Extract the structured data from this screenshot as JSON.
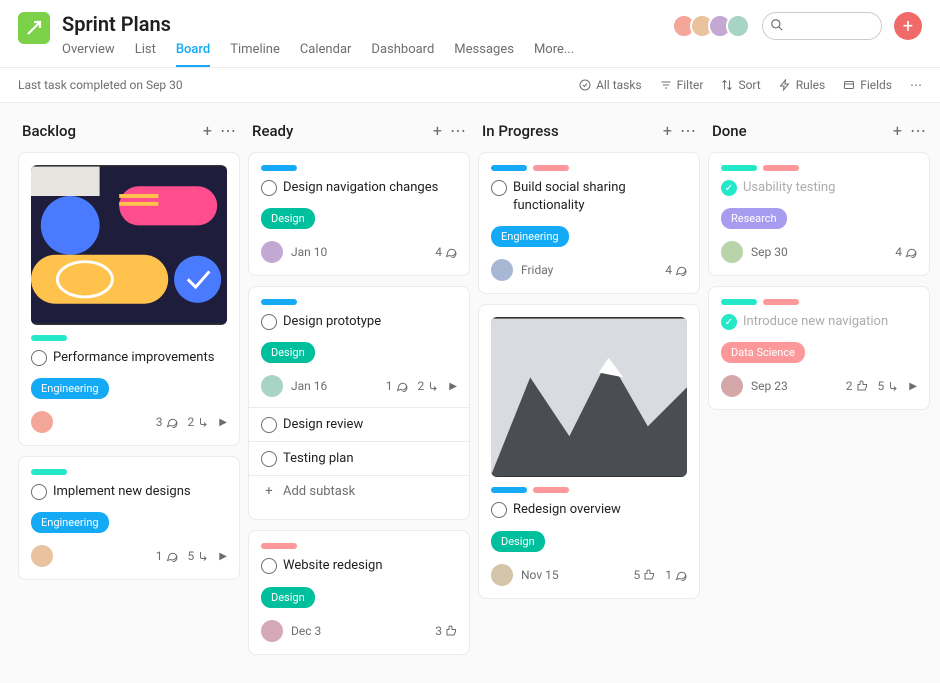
{
  "header": {
    "title": "Sprint Plans",
    "tabs": [
      "Overview",
      "List",
      "Board",
      "Timeline",
      "Calendar",
      "Dashboard",
      "Messages",
      "More..."
    ],
    "active_tab": "Board",
    "search_placeholder": ""
  },
  "toolbar": {
    "status": "Last task completed on Sep 30",
    "all_tasks": "All tasks",
    "filter": "Filter",
    "sort": "Sort",
    "rules": "Rules",
    "fields": "Fields"
  },
  "columns": [
    {
      "name": "Backlog",
      "cards": [
        {
          "has_cover": true,
          "cover_type": "abstract",
          "pills": [
            "teal"
          ],
          "title": "Performance improvements",
          "tag": {
            "label": "Engineering",
            "class": "engineering"
          },
          "assignee": "p1",
          "date": "",
          "stats": {
            "comments": 3,
            "subtasks": 2,
            "expand": true
          }
        },
        {
          "pills": [
            "teal"
          ],
          "title": "Implement new designs",
          "tag": {
            "label": "Engineering",
            "class": "engineering"
          },
          "assignee": "p2",
          "date": "",
          "stats": {
            "comments": 1,
            "subtasks": 5,
            "expand": true
          }
        }
      ]
    },
    {
      "name": "Ready",
      "cards": [
        {
          "pills": [
            "blue"
          ],
          "title": "Design navigation changes",
          "tag": {
            "label": "Design",
            "class": "design"
          },
          "assignee": "p3",
          "date": "Jan 10",
          "stats": {
            "comments": 4
          }
        },
        {
          "pills": [
            "blue"
          ],
          "title": "Design prototype",
          "tag": {
            "label": "Design",
            "class": "design"
          },
          "assignee": "p4",
          "date": "Jan 16",
          "stats": {
            "comments": 1,
            "subtasks": 2,
            "expand": true
          },
          "subtask_list": [
            "Design review",
            "Testing plan"
          ],
          "add_subtask_label": "Add subtask"
        },
        {
          "pills": [
            "pink"
          ],
          "title": "Website redesign",
          "tag": {
            "label": "Design",
            "class": "design"
          },
          "assignee": "p5",
          "date": "Dec 3",
          "stats": {
            "likes": 3
          }
        }
      ]
    },
    {
      "name": "In Progress",
      "cards": [
        {
          "pills": [
            "blue",
            "pink"
          ],
          "title": "Build social sharing functionality",
          "tag": {
            "label": "Engineering",
            "class": "engineering"
          },
          "assignee": "p6",
          "date": "Friday",
          "stats": {
            "comments": 4
          }
        },
        {
          "has_cover": true,
          "cover_type": "mountain",
          "pills": [
            "blue",
            "pink"
          ],
          "title": "Redesign overview",
          "tag": {
            "label": "Design",
            "class": "design"
          },
          "assignee": "p7",
          "date": "Nov 15",
          "stats": {
            "likes": 5,
            "comments": 1
          }
        }
      ]
    },
    {
      "name": "Done",
      "cards": [
        {
          "faded": true,
          "done": true,
          "pills": [
            "teal",
            "pink"
          ],
          "title": "Usability testing",
          "tag": {
            "label": "Research",
            "class": "research"
          },
          "assignee": "p8",
          "date": "Sep 30",
          "stats": {
            "comments": 4
          }
        },
        {
          "faded": true,
          "done": true,
          "pills": [
            "teal",
            "pink"
          ],
          "title": "Introduce new navigation",
          "tag": {
            "label": "Data Science",
            "class": "datascience"
          },
          "assignee": "p9",
          "date": "Sep 23",
          "stats": {
            "likes": 2,
            "subtasks": 5,
            "expand": true
          }
        }
      ]
    }
  ]
}
